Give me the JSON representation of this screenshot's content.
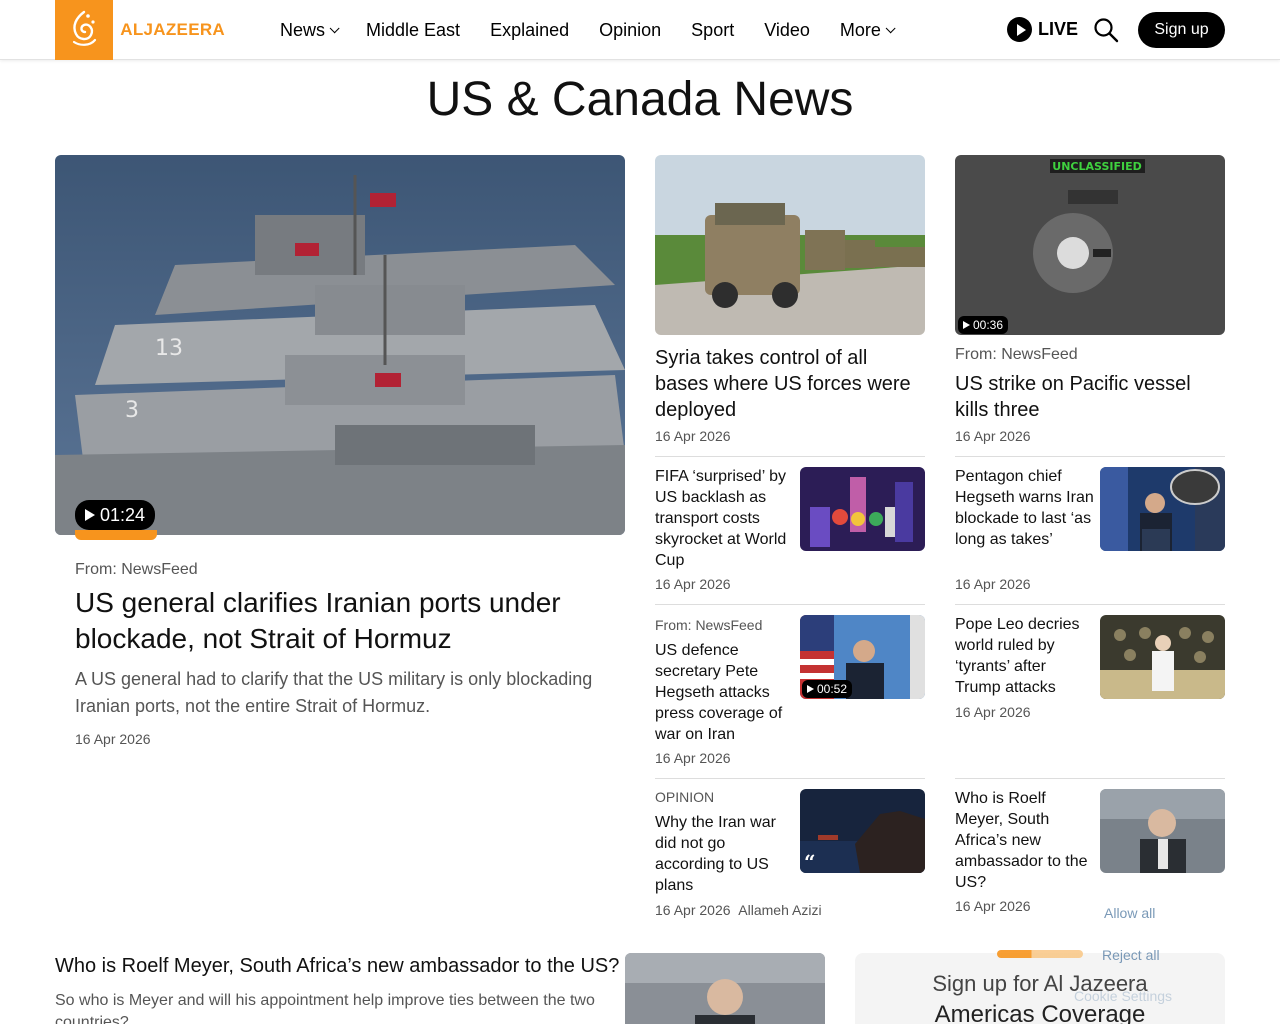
{
  "header": {
    "logo_text": "ALJAZEERA",
    "nav": [
      {
        "label": "News",
        "has_menu": true
      },
      {
        "label": "Middle East",
        "has_menu": false
      },
      {
        "label": "Explained",
        "has_menu": false
      },
      {
        "label": "Opinion",
        "has_menu": false
      },
      {
        "label": "Sport",
        "has_menu": false
      },
      {
        "label": "Video",
        "has_menu": false
      },
      {
        "label": "More",
        "has_menu": true
      }
    ],
    "live_label": "LIVE",
    "signup_label": "Sign up",
    "brand_color": "#f7941d"
  },
  "page_title": "US & Canada News",
  "featured": {
    "duration": "01:24",
    "source": "From: NewsFeed",
    "headline": "US general clarifies Iranian ports under blockade, not Strait of Hormuz",
    "summary": "A US general had to clarify that the US military is only blockading Iranian ports, not the entire Strait of Hormuz.",
    "date": "16 Apr 2026"
  },
  "top_cards": [
    {
      "headline": "Syria takes control of all bases where US forces were deployed",
      "date": "16 Apr 2026",
      "image_label": ""
    },
    {
      "duration": "00:36",
      "image_label": "UNCLASSIFIED",
      "source": "From: NewsFeed",
      "headline": "US strike on Pacific vessel kills three",
      "date": "16 Apr 2026"
    }
  ],
  "small_cards": [
    {
      "headline": "FIFA ‘surprised’ by US backlash as transport costs skyrocket at World Cup",
      "date": "16 Apr 2026"
    },
    {
      "headline": "Pentagon chief Hegseth warns Iran blockade to last ‘as long as takes’",
      "date": "16 Apr 2026"
    },
    {
      "source": "From: NewsFeed",
      "headline": "US defence secretary Pete Hegseth attacks press coverage of war on Iran",
      "date": "16 Apr 2026",
      "duration": "00:52"
    },
    {
      "headline": "Pope Leo decries world ruled by ‘tyrants’ after Trump attacks",
      "date": "16 Apr 2026"
    },
    {
      "source": "OPINION",
      "headline": "Why the Iran war did not go according to US plans",
      "date": "16 Apr 2026",
      "author": "Allameh Azizi"
    },
    {
      "headline": "Who is Roelf Meyer, South Africa’s new ambassador to the US?",
      "date": "16 Apr 2026"
    }
  ],
  "bottom": {
    "headline": "Who is Roelf Meyer, South Africa’s new ambassador to the US?",
    "summary": "So who is Meyer and will his appointment help improve ties between the two countries?"
  },
  "newsletter": {
    "line1": "Sign up for Al Jazeera",
    "line2": "Americas Coverage"
  },
  "consent": {
    "allow": "Allow all",
    "reject": "Reject all",
    "settings": "Cookie Settings"
  }
}
